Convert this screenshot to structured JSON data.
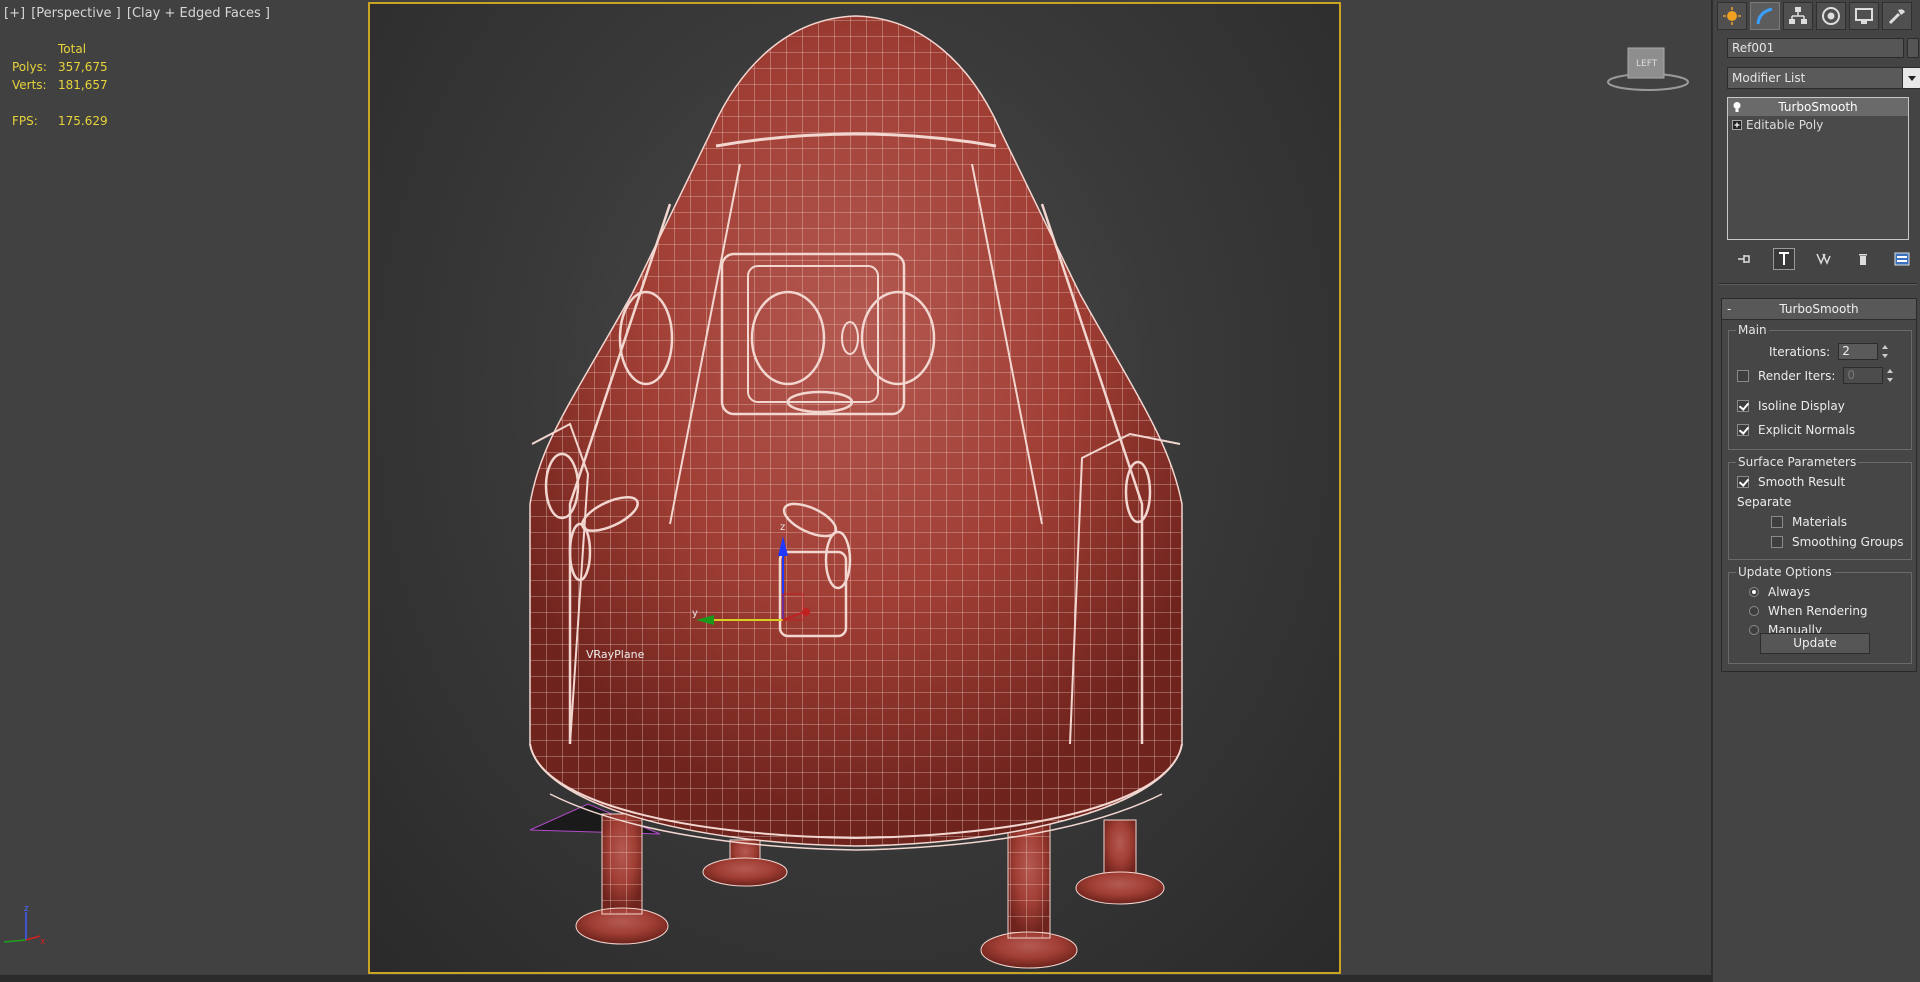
{
  "viewport": {
    "label_parts": [
      "[+]",
      "[Perspective ]",
      "[Clay + Edged Faces ]"
    ],
    "stats": {
      "header": "Total",
      "polys_label": "Polys:",
      "polys_value": "357,675",
      "verts_label": "Verts:",
      "verts_value": "181,657",
      "fps_label": "FPS:",
      "fps_value": "175.629"
    },
    "object_label": "VRayPlane",
    "viewcube_label": "LEFT",
    "gizmo_axis_y": "y",
    "gizmo_axis_z": "z",
    "tripod_z": "z",
    "tripod_x": "x",
    "frame_color": "#c9a422",
    "model_color": "#a8443a",
    "wire_color": "#f2d6d0"
  },
  "command_panel": {
    "tabs": [
      "create-icon",
      "modify-icon",
      "hierarchy-icon",
      "motion-icon",
      "display-icon",
      "utilities-icon"
    ],
    "object_name": "Ref001",
    "modifier_list": "Modifier List",
    "stack": [
      {
        "label": "TurboSmooth",
        "icon": "lightbulb-icon",
        "selected": true
      },
      {
        "label": "Editable Poly",
        "icon": "expand-plus-icon",
        "selected": false
      }
    ],
    "rollout": {
      "title": "TurboSmooth",
      "collapse": "-",
      "main": {
        "title": "Main",
        "iterations_label": "Iterations:",
        "iterations_value": "2",
        "render_iters_label": "Render Iters:",
        "render_iters_value": "0",
        "isoline_label": "Isoline Display",
        "explicit_normals_label": "Explicit Normals"
      },
      "surface": {
        "title": "Surface Parameters",
        "smooth_result_label": "Smooth Result",
        "separate_label": "Separate",
        "materials_label": "Materials",
        "smoothing_groups_label": "Smoothing Groups"
      },
      "update": {
        "title": "Update Options",
        "always_label": "Always",
        "when_rendering_label": "When Rendering",
        "manually_label": "Manually",
        "button_label": "Update"
      }
    }
  }
}
